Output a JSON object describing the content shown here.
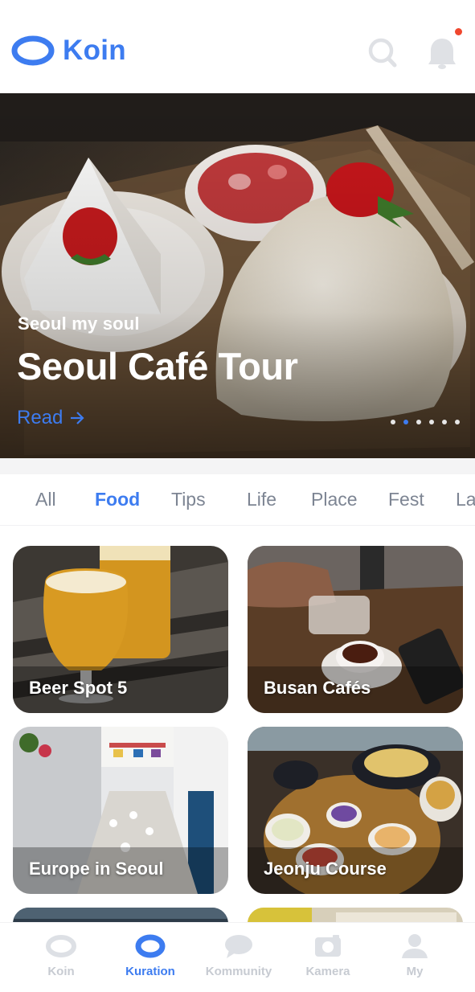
{
  "header": {
    "app_name": "Koin",
    "brand_color": "#3d7cf0",
    "icons": [
      "search-icon",
      "bell-icon"
    ],
    "has_notification": true
  },
  "hero": {
    "subtitle": "Seoul my soul",
    "title": "Seoul Café Tour",
    "read_label": "Read",
    "read_icon": "arrow-right-icon",
    "slide_count": 6,
    "active_slide": 2
  },
  "tabs": {
    "items": [
      "All",
      "Food",
      "Tips",
      "Life",
      "Place",
      "Fest",
      "La"
    ],
    "active": "Food"
  },
  "cards": [
    {
      "title": "Beer Spot 5"
    },
    {
      "title": "Busan Cafés"
    },
    {
      "title": "Europe in Seoul"
    },
    {
      "title": "Jeonju Course"
    }
  ],
  "nav": {
    "items": [
      {
        "label": "Koin",
        "icon": "koin-logo-icon"
      },
      {
        "label": "Kuration",
        "icon": "kuration-icon"
      },
      {
        "label": "Kommunity",
        "icon": "chat-bubble-icon"
      },
      {
        "label": "Kamera",
        "icon": "camera-icon"
      },
      {
        "label": "My",
        "icon": "profile-icon"
      }
    ],
    "active": "Kuration",
    "active_color": "#3d7cf0",
    "inactive_color": "#c7cbd2"
  }
}
